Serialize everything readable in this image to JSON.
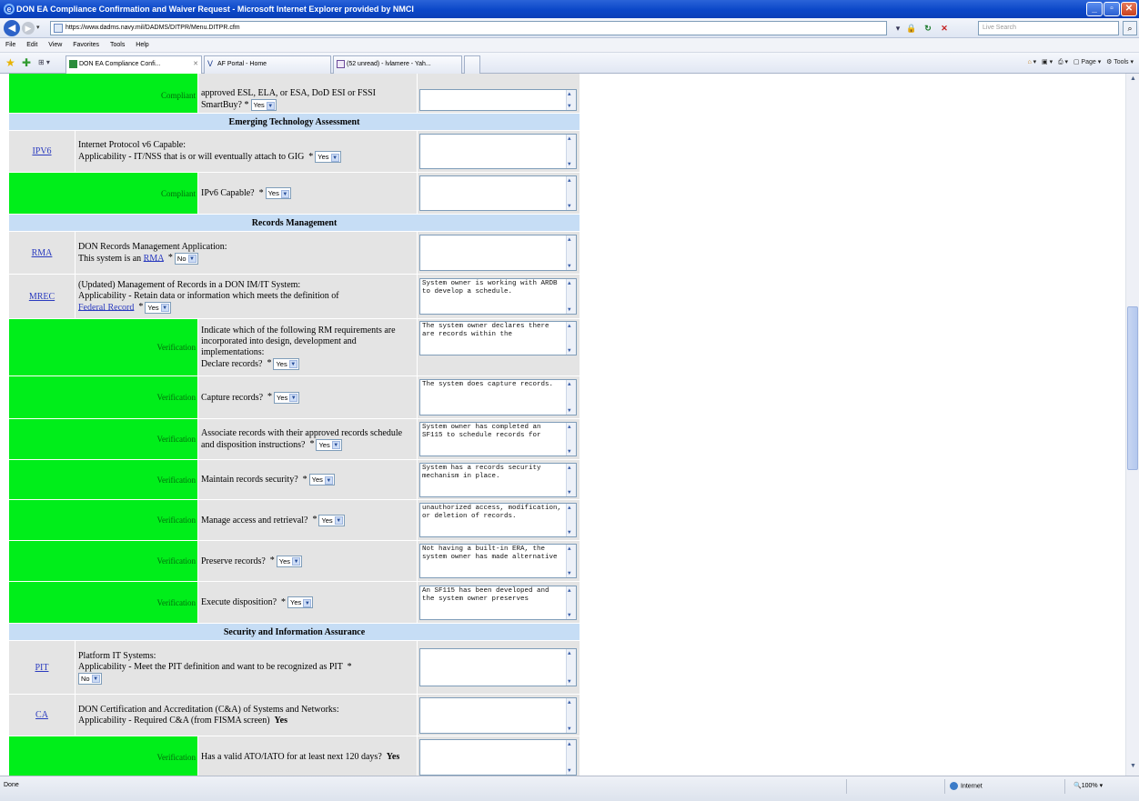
{
  "window": {
    "title": "DON EA Compliance Confirmation and Waiver Request - Microsoft Internet Explorer provided by NMCI"
  },
  "nav": {
    "url": "https://www.dadms.navy.mil/DADMS/DITPR/Menu.DITPR.cfm",
    "search_placeholder": "Live Search"
  },
  "menu": {
    "file": "File",
    "edit": "Edit",
    "view": "View",
    "favorites": "Favorites",
    "tools": "Tools",
    "help": "Help"
  },
  "tabs": [
    {
      "label": "DON EA Compliance Confi..."
    },
    {
      "label": "AF Portal - Home"
    },
    {
      "label": "(52 unread) - lvlamere - Yah..."
    }
  ],
  "toolbar": {
    "page": "Page",
    "tools": "Tools"
  },
  "status": {
    "text": "Done",
    "zone": "Internet",
    "zoom": "100%"
  },
  "form": {
    "top": {
      "label": "Compliant",
      "question": "approved ESL, ELA, or ESA, DoD ESI or FSSI SmartBuy?",
      "value": "Yes"
    },
    "sections": {
      "emerging": "Emerging Technology Assessment",
      "records": "Records Management",
      "security": "Security and Information Assurance"
    },
    "ipv6": {
      "acronym": "IPV6",
      "desc1": "Internet Protocol v6 Capable:",
      "desc2": "Applicability - IT/NSS that is or will eventually attach to GIG",
      "value": "Yes"
    },
    "ipv6_compliant": {
      "label": "Compliant",
      "question": "IPv6 Capable?",
      "value": "Yes"
    },
    "rma": {
      "acronym": "RMA",
      "desc1": "DON Records Management Application:",
      "desc2": "This system is an",
      "link": "RMA",
      "value": "No"
    },
    "mrec": {
      "acronym": "MREC",
      "desc1": "(Updated) Management of Records in a DON IM/IT System:",
      "desc2": "Applicability - Retain data or information which meets the definition of",
      "link": "Federal Record",
      "value": "Yes",
      "comment": "System owner is working with ARDB to develop a schedule."
    },
    "verifications": [
      {
        "label": "Verification",
        "question": "Indicate which of the following RM requirements are incorporated into design, development and implementations:",
        "question2": "Declare records?",
        "value": "Yes",
        "comment": "The system owner declares there are records within the"
      },
      {
        "label": "Verification",
        "question": "Capture records?",
        "value": "Yes",
        "comment": "The system does capture records."
      },
      {
        "label": "Verification",
        "question": "Associate records with their approved records schedule and disposition instructions?",
        "value": "Yes",
        "comment": "System owner has completed an SF115 to schedule records for"
      },
      {
        "label": "Verification",
        "question": "Maintain records security?",
        "value": "Yes",
        "comment": "System has a records security mechanism in place."
      },
      {
        "label": "Verification",
        "question": "Manage access and retrieval?",
        "value": "Yes",
        "comment": "unauthorized access, modification, or deletion of records."
      },
      {
        "label": "Verification",
        "question": "Preserve records?",
        "value": "Yes",
        "comment": "Not having a built-in ERA, the system owner has made alternative"
      },
      {
        "label": "Verification",
        "question": "Execute disposition?",
        "value": "Yes",
        "comment": "An SF115 has been developed and the system owner preserves"
      }
    ],
    "pit": {
      "acronym": "PIT",
      "desc1": "Platform IT Systems:",
      "desc2": "Applicability - Meet the PIT definition and want to be recognized as PIT",
      "value": "No"
    },
    "ca": {
      "acronym": "CA",
      "desc1": "DON Certification and Accreditation (C&A) of Systems and Networks:",
      "desc2": "Applicability - Required C&A (from FISMA screen)",
      "answer": "Yes"
    },
    "ato": {
      "label": "Verification",
      "question": "Has a valid ATO/IATO for at least next 120 days?",
      "answer": "Yes"
    }
  }
}
